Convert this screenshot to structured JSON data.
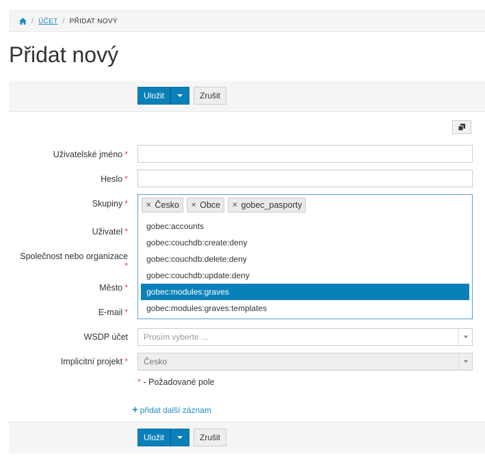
{
  "breadcrumb": {
    "items": [
      "ÚČET",
      "PŘIDAT NOVÝ"
    ]
  },
  "page": {
    "title": "Přidat nový"
  },
  "toolbar": {
    "save_label": "Uložit",
    "cancel_label": "Zrušit"
  },
  "form": {
    "required_mark": "*",
    "username_label": "Uživatelské jméno",
    "password_label": "Heslo",
    "groups_label": "Skupiny",
    "user_label": "Uživatel",
    "org_label": "Společnost nebo organizace",
    "city_label": "Město",
    "email_label": "E-mail",
    "wsdp_label": "WSDP účet",
    "wsdp_placeholder": "Prosím vyberte ...",
    "project_label": "Implicitní projekt",
    "project_value": "Česko",
    "groups_tags": [
      "Česko",
      "Obce",
      "gobec_pasporty"
    ],
    "groups_options": [
      "gobec:accounts",
      "gobec:couchdb:create:deny",
      "gobec:couchdb:delete:deny",
      "gobec:couchdb:update:deny",
      "gobec:modules:graves",
      "gobec:modules:graves:templates"
    ],
    "groups_active_option": "gobec:modules:graves",
    "required_note": "- Požadované pole",
    "add_link": "přidat další záznam"
  },
  "colors": {
    "primary": "#0a80b8",
    "link": "#1a8cc4",
    "required": "#d9534f"
  }
}
